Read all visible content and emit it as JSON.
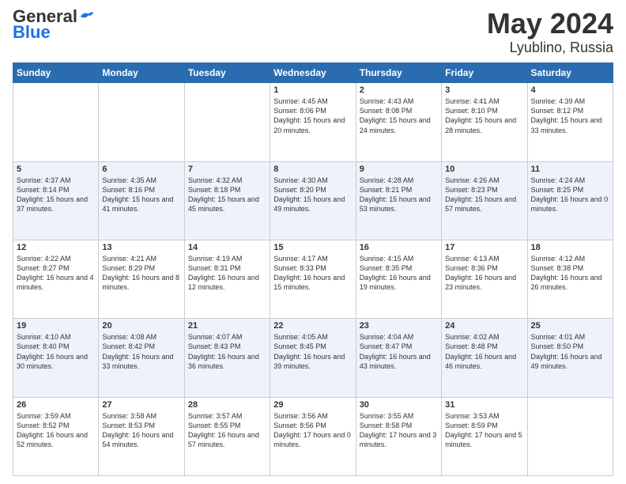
{
  "header": {
    "logo": {
      "general": "General",
      "blue": "Blue"
    },
    "title": "May 2024",
    "location": "Lyublino, Russia"
  },
  "days_of_week": [
    "Sunday",
    "Monday",
    "Tuesday",
    "Wednesday",
    "Thursday",
    "Friday",
    "Saturday"
  ],
  "weeks": [
    [
      {
        "day": "",
        "info": ""
      },
      {
        "day": "",
        "info": ""
      },
      {
        "day": "",
        "info": ""
      },
      {
        "day": "1",
        "sunrise": "4:45 AM",
        "sunset": "8:06 PM",
        "daylight": "15 hours and 20 minutes."
      },
      {
        "day": "2",
        "sunrise": "4:43 AM",
        "sunset": "8:08 PM",
        "daylight": "15 hours and 24 minutes."
      },
      {
        "day": "3",
        "sunrise": "4:41 AM",
        "sunset": "8:10 PM",
        "daylight": "15 hours and 28 minutes."
      },
      {
        "day": "4",
        "sunrise": "4:39 AM",
        "sunset": "8:12 PM",
        "daylight": "15 hours and 33 minutes."
      }
    ],
    [
      {
        "day": "5",
        "sunrise": "4:37 AM",
        "sunset": "8:14 PM",
        "daylight": "15 hours and 37 minutes."
      },
      {
        "day": "6",
        "sunrise": "4:35 AM",
        "sunset": "8:16 PM",
        "daylight": "15 hours and 41 minutes."
      },
      {
        "day": "7",
        "sunrise": "4:32 AM",
        "sunset": "8:18 PM",
        "daylight": "15 hours and 45 minutes."
      },
      {
        "day": "8",
        "sunrise": "4:30 AM",
        "sunset": "8:20 PM",
        "daylight": "15 hours and 49 minutes."
      },
      {
        "day": "9",
        "sunrise": "4:28 AM",
        "sunset": "8:21 PM",
        "daylight": "15 hours and 53 minutes."
      },
      {
        "day": "10",
        "sunrise": "4:26 AM",
        "sunset": "8:23 PM",
        "daylight": "15 hours and 57 minutes."
      },
      {
        "day": "11",
        "sunrise": "4:24 AM",
        "sunset": "8:25 PM",
        "daylight": "16 hours and 0 minutes."
      }
    ],
    [
      {
        "day": "12",
        "sunrise": "4:22 AM",
        "sunset": "8:27 PM",
        "daylight": "16 hours and 4 minutes."
      },
      {
        "day": "13",
        "sunrise": "4:21 AM",
        "sunset": "8:29 PM",
        "daylight": "16 hours and 8 minutes."
      },
      {
        "day": "14",
        "sunrise": "4:19 AM",
        "sunset": "8:31 PM",
        "daylight": "16 hours and 12 minutes."
      },
      {
        "day": "15",
        "sunrise": "4:17 AM",
        "sunset": "8:33 PM",
        "daylight": "16 hours and 15 minutes."
      },
      {
        "day": "16",
        "sunrise": "4:15 AM",
        "sunset": "8:35 PM",
        "daylight": "16 hours and 19 minutes."
      },
      {
        "day": "17",
        "sunrise": "4:13 AM",
        "sunset": "8:36 PM",
        "daylight": "16 hours and 23 minutes."
      },
      {
        "day": "18",
        "sunrise": "4:12 AM",
        "sunset": "8:38 PM",
        "daylight": "16 hours and 26 minutes."
      }
    ],
    [
      {
        "day": "19",
        "sunrise": "4:10 AM",
        "sunset": "8:40 PM",
        "daylight": "16 hours and 30 minutes."
      },
      {
        "day": "20",
        "sunrise": "4:08 AM",
        "sunset": "8:42 PM",
        "daylight": "16 hours and 33 minutes."
      },
      {
        "day": "21",
        "sunrise": "4:07 AM",
        "sunset": "8:43 PM",
        "daylight": "16 hours and 36 minutes."
      },
      {
        "day": "22",
        "sunrise": "4:05 AM",
        "sunset": "8:45 PM",
        "daylight": "16 hours and 39 minutes."
      },
      {
        "day": "23",
        "sunrise": "4:04 AM",
        "sunset": "8:47 PM",
        "daylight": "16 hours and 43 minutes."
      },
      {
        "day": "24",
        "sunrise": "4:02 AM",
        "sunset": "8:48 PM",
        "daylight": "16 hours and 46 minutes."
      },
      {
        "day": "25",
        "sunrise": "4:01 AM",
        "sunset": "8:50 PM",
        "daylight": "16 hours and 49 minutes."
      }
    ],
    [
      {
        "day": "26",
        "sunrise": "3:59 AM",
        "sunset": "8:52 PM",
        "daylight": "16 hours and 52 minutes."
      },
      {
        "day": "27",
        "sunrise": "3:58 AM",
        "sunset": "8:53 PM",
        "daylight": "16 hours and 54 minutes."
      },
      {
        "day": "28",
        "sunrise": "3:57 AM",
        "sunset": "8:55 PM",
        "daylight": "16 hours and 57 minutes."
      },
      {
        "day": "29",
        "sunrise": "3:56 AM",
        "sunset": "8:56 PM",
        "daylight": "17 hours and 0 minutes."
      },
      {
        "day": "30",
        "sunrise": "3:55 AM",
        "sunset": "8:58 PM",
        "daylight": "17 hours and 3 minutes."
      },
      {
        "day": "31",
        "sunrise": "3:53 AM",
        "sunset": "8:59 PM",
        "daylight": "17 hours and 5 minutes."
      },
      {
        "day": "",
        "info": ""
      }
    ]
  ]
}
